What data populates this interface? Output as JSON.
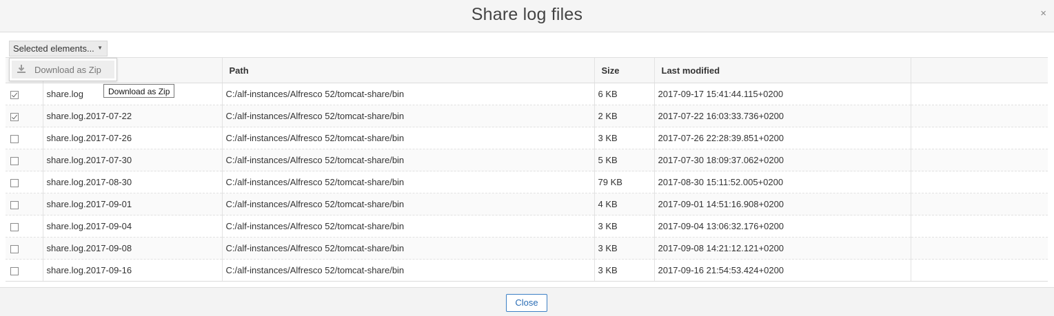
{
  "dialog": {
    "title": "Share log files",
    "close_icon": "×",
    "close_button": "Close"
  },
  "toolbar": {
    "selected_label": "Selected elements...",
    "dropdown_icon": "▼"
  },
  "menu": {
    "download_zip": "Download as Zip",
    "icon": "download-icon"
  },
  "tooltip": {
    "text": "Download as Zip"
  },
  "table": {
    "columns": [
      "",
      "Path",
      "Size",
      "Last modified",
      ""
    ],
    "rows": [
      {
        "checked": true,
        "name": "share.log",
        "path": "C:/alf-instances/Alfresco 52/tomcat-share/bin",
        "size": "6 KB",
        "modified": "2017-09-17 15:41:44.115+0200"
      },
      {
        "checked": true,
        "name": "share.log.2017-07-22",
        "path": "C:/alf-instances/Alfresco 52/tomcat-share/bin",
        "size": "2 KB",
        "modified": "2017-07-22 16:03:33.736+0200"
      },
      {
        "checked": false,
        "name": "share.log.2017-07-26",
        "path": "C:/alf-instances/Alfresco 52/tomcat-share/bin",
        "size": "3 KB",
        "modified": "2017-07-26 22:28:39.851+0200"
      },
      {
        "checked": false,
        "name": "share.log.2017-07-30",
        "path": "C:/alf-instances/Alfresco 52/tomcat-share/bin",
        "size": "5 KB",
        "modified": "2017-07-30 18:09:37.062+0200"
      },
      {
        "checked": false,
        "name": "share.log.2017-08-30",
        "path": "C:/alf-instances/Alfresco 52/tomcat-share/bin",
        "size": "79 KB",
        "modified": "2017-08-30 15:11:52.005+0200"
      },
      {
        "checked": false,
        "name": "share.log.2017-09-01",
        "path": "C:/alf-instances/Alfresco 52/tomcat-share/bin",
        "size": "4 KB",
        "modified": "2017-09-01 14:51:16.908+0200"
      },
      {
        "checked": false,
        "name": "share.log.2017-09-04",
        "path": "C:/alf-instances/Alfresco 52/tomcat-share/bin",
        "size": "3 KB",
        "modified": "2017-09-04 13:06:32.176+0200"
      },
      {
        "checked": false,
        "name": "share.log.2017-09-08",
        "path": "C:/alf-instances/Alfresco 52/tomcat-share/bin",
        "size": "3 KB",
        "modified": "2017-09-08 14:21:12.121+0200"
      },
      {
        "checked": false,
        "name": "share.log.2017-09-16",
        "path": "C:/alf-instances/Alfresco 52/tomcat-share/bin",
        "size": "3 KB",
        "modified": "2017-09-16 21:54:53.424+0200"
      }
    ]
  }
}
